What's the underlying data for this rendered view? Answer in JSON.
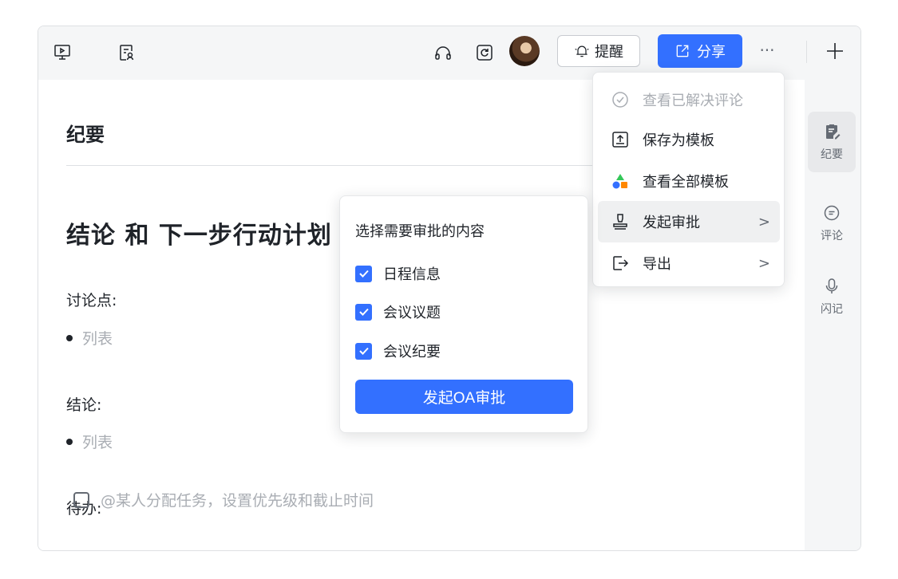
{
  "toolbar": {
    "remind_label": "提醒",
    "share_label": "分享",
    "more_label": "···"
  },
  "icons": {
    "present": "present-icon",
    "reader": "reader-icon",
    "headphones": "headphones-icon",
    "refresh": "refresh-icon",
    "bell": "bell-icon",
    "share": "share-icon",
    "plus": "plus-icon"
  },
  "document": {
    "title": "纪要",
    "heading": "结论 和 下一步行动计划",
    "discussion_label": "讨论点:",
    "discussion_placeholder": "列表",
    "conclusion_label": "结论:",
    "conclusion_placeholder": "列表",
    "todo_label": "待办:",
    "todo_placeholder": "@某人分配任务，设置优先级和截止时间"
  },
  "sidebar": {
    "items": [
      {
        "label": "纪要",
        "icon": "notes-icon"
      },
      {
        "label": "评论",
        "icon": "comment-icon"
      },
      {
        "label": "闪记",
        "icon": "microphone-icon"
      }
    ]
  },
  "menu": {
    "items": [
      {
        "label": "查看已解决评论",
        "icon": "check-circle-icon"
      },
      {
        "label": "保存为模板",
        "icon": "save-template-icon"
      },
      {
        "label": "查看全部模板",
        "icon": "templates-icon"
      },
      {
        "label": "发起审批",
        "icon": "stamp-icon"
      },
      {
        "label": "导出",
        "icon": "export-icon"
      }
    ]
  },
  "approval": {
    "title": "选择需要审批的内容",
    "options": [
      {
        "label": "日程信息",
        "checked": true
      },
      {
        "label": "会议议题",
        "checked": true
      },
      {
        "label": "会议纪要",
        "checked": true
      }
    ],
    "submit_label": "发起OA审批"
  },
  "colors": {
    "accent": "#3370ff",
    "toolbar_bg": "#f5f6f7",
    "text": "#1f2329",
    "placeholder": "#a9adb3"
  }
}
